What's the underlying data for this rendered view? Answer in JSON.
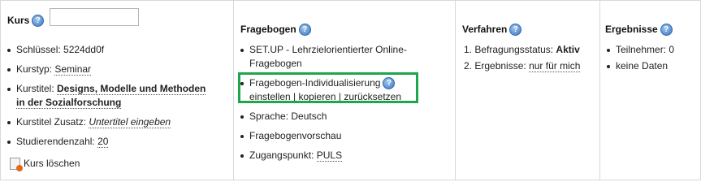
{
  "kurs": {
    "title": "Kurs",
    "search_value": "",
    "items": [
      {
        "label": "Schlüssel: ",
        "value": "5224dd0f"
      },
      {
        "label": "Kurstyp: ",
        "value": "Seminar"
      },
      {
        "label": "Kurstitel: ",
        "value": "Designs, Modelle und Methoden in der Sozialforschung"
      },
      {
        "label": "Kurstitel Zusatz: ",
        "value": "Untertitel eingeben"
      },
      {
        "label": "Studierendenzahl: ",
        "value": "20"
      }
    ],
    "delete_label": "Kurs löschen"
  },
  "fragebogen": {
    "title": "Fragebogen",
    "items": [
      {
        "text": "SET.UP - Lehrzielorientierter Online-Fragebogen"
      },
      {
        "text": "Fragebogen-Individualisierung"
      },
      {
        "label": "Sprache: ",
        "value": "Deutsch"
      },
      {
        "text": "Fragebogenvorschau"
      },
      {
        "label": "Zugangspunkt: ",
        "value": "PULS"
      }
    ],
    "actions": [
      "einstellen",
      "kopieren",
      "zurücksetzen"
    ],
    "separator": " | "
  },
  "verfahren": {
    "title": "Verfahren",
    "items": [
      {
        "number": "1.",
        "label": "Befragungsstatus: ",
        "value": "Aktiv"
      },
      {
        "number": "2.",
        "label": "Ergebnisse: ",
        "value": "nur für mich"
      }
    ]
  },
  "ergebnisse": {
    "title": "Ergebnisse",
    "items": [
      {
        "text": "Teilnehmer: 0"
      },
      {
        "text": "keine Daten"
      }
    ]
  },
  "colors": {
    "highlight_border": "#1fa64a",
    "help_icon": "#3a78c2",
    "delete_icon": "#e06a1a"
  }
}
